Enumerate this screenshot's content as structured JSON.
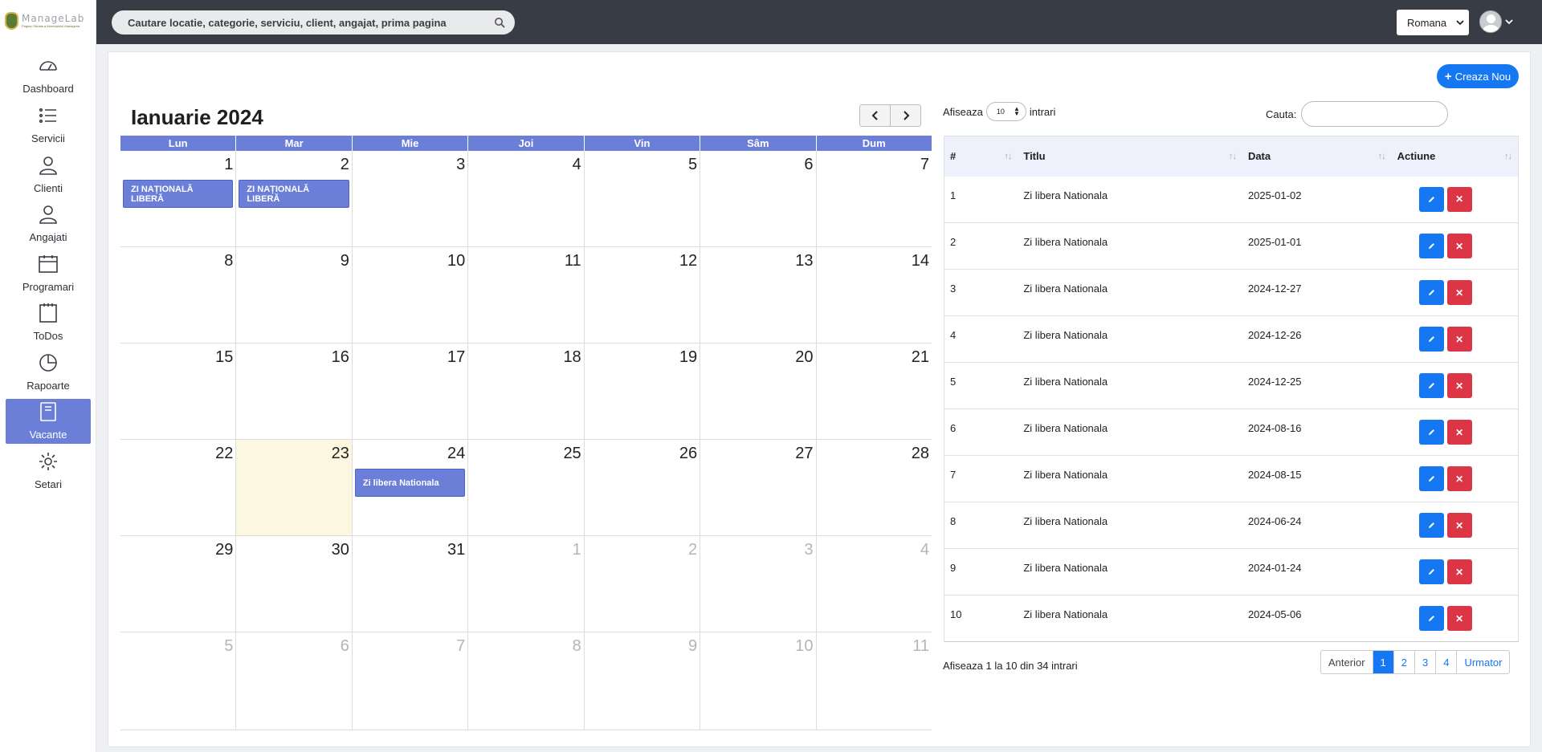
{
  "logo": {
    "text": "ManageLab",
    "subtext": "Pagina Oficiala a Municipiului Manageria"
  },
  "sidebar": {
    "items": [
      {
        "label": "Dashboard"
      },
      {
        "label": "Servicii"
      },
      {
        "label": "Clienti"
      },
      {
        "label": "Angajati"
      },
      {
        "label": "Programari"
      },
      {
        "label": "ToDos"
      },
      {
        "label": "Rapoarte"
      },
      {
        "label": "Vacante",
        "active": true
      },
      {
        "label": "Setari"
      }
    ]
  },
  "header": {
    "search_placeholder": "Cautare locatie, categorie, serviciu, client, angajat, prima pagina",
    "language": "Romana"
  },
  "actions": {
    "create_label": "Creaza Nou"
  },
  "calendar": {
    "title": "Ianuarie 2024",
    "weekdays": [
      "Lun",
      "Mar",
      "Mie",
      "Joi",
      "Vin",
      "Sâm",
      "Dum"
    ],
    "weeks": [
      [
        "1",
        "2",
        "3",
        "4",
        "5",
        "6",
        "7"
      ],
      [
        "8",
        "9",
        "10",
        "11",
        "12",
        "13",
        "14"
      ],
      [
        "15",
        "16",
        "17",
        "18",
        "19",
        "20",
        "21"
      ],
      [
        "22",
        "23",
        "24",
        "25",
        "26",
        "27",
        "28"
      ],
      [
        "29",
        "30",
        "31",
        "1",
        "2",
        "3",
        "4"
      ],
      [
        "5",
        "6",
        "7",
        "8",
        "9",
        "10",
        "11"
      ]
    ],
    "events": [
      {
        "label": "ZI NAȚIONALĂ LIBERĂ"
      },
      {
        "label": "ZI NAȚIONALĂ LIBERĂ"
      },
      {
        "label": "Zi libera Nationala"
      }
    ]
  },
  "table": {
    "show_label": "Afiseaza",
    "entries_value": "10",
    "entries_label": "intrari",
    "search_label": "Cauta:",
    "columns": [
      "#",
      "Titlu",
      "Data",
      "Actiune"
    ],
    "rows": [
      {
        "id": "1",
        "title": "Zi libera Nationala",
        "date": "2025-01-02"
      },
      {
        "id": "2",
        "title": "Zi libera Nationala",
        "date": "2025-01-01"
      },
      {
        "id": "3",
        "title": "Zi libera Nationala",
        "date": "2024-12-27"
      },
      {
        "id": "4",
        "title": "Zi libera Nationala",
        "date": "2024-12-26"
      },
      {
        "id": "5",
        "title": "Zi libera Nationala",
        "date": "2024-12-25"
      },
      {
        "id": "6",
        "title": "Zi libera Nationala",
        "date": "2024-08-16"
      },
      {
        "id": "7",
        "title": "Zi libera Nationala",
        "date": "2024-08-15"
      },
      {
        "id": "8",
        "title": "Zi libera Nationala",
        "date": "2024-06-24"
      },
      {
        "id": "9",
        "title": "Zi libera Nationala",
        "date": "2024-01-24"
      },
      {
        "id": "10",
        "title": "Zi libera Nationala",
        "date": "2024-05-06"
      }
    ],
    "info": "Afiseaza 1 la 10 din 34 intrari",
    "pagination": {
      "prev": "Anterior",
      "pages": [
        "1",
        "2",
        "3",
        "4"
      ],
      "current": "1",
      "next": "Urmator"
    }
  },
  "colors": {
    "accent": "#6b7fd8",
    "primary": "#1677f2",
    "danger": "#dc3545",
    "header": "#383d45",
    "today": "#fbf7e1"
  }
}
